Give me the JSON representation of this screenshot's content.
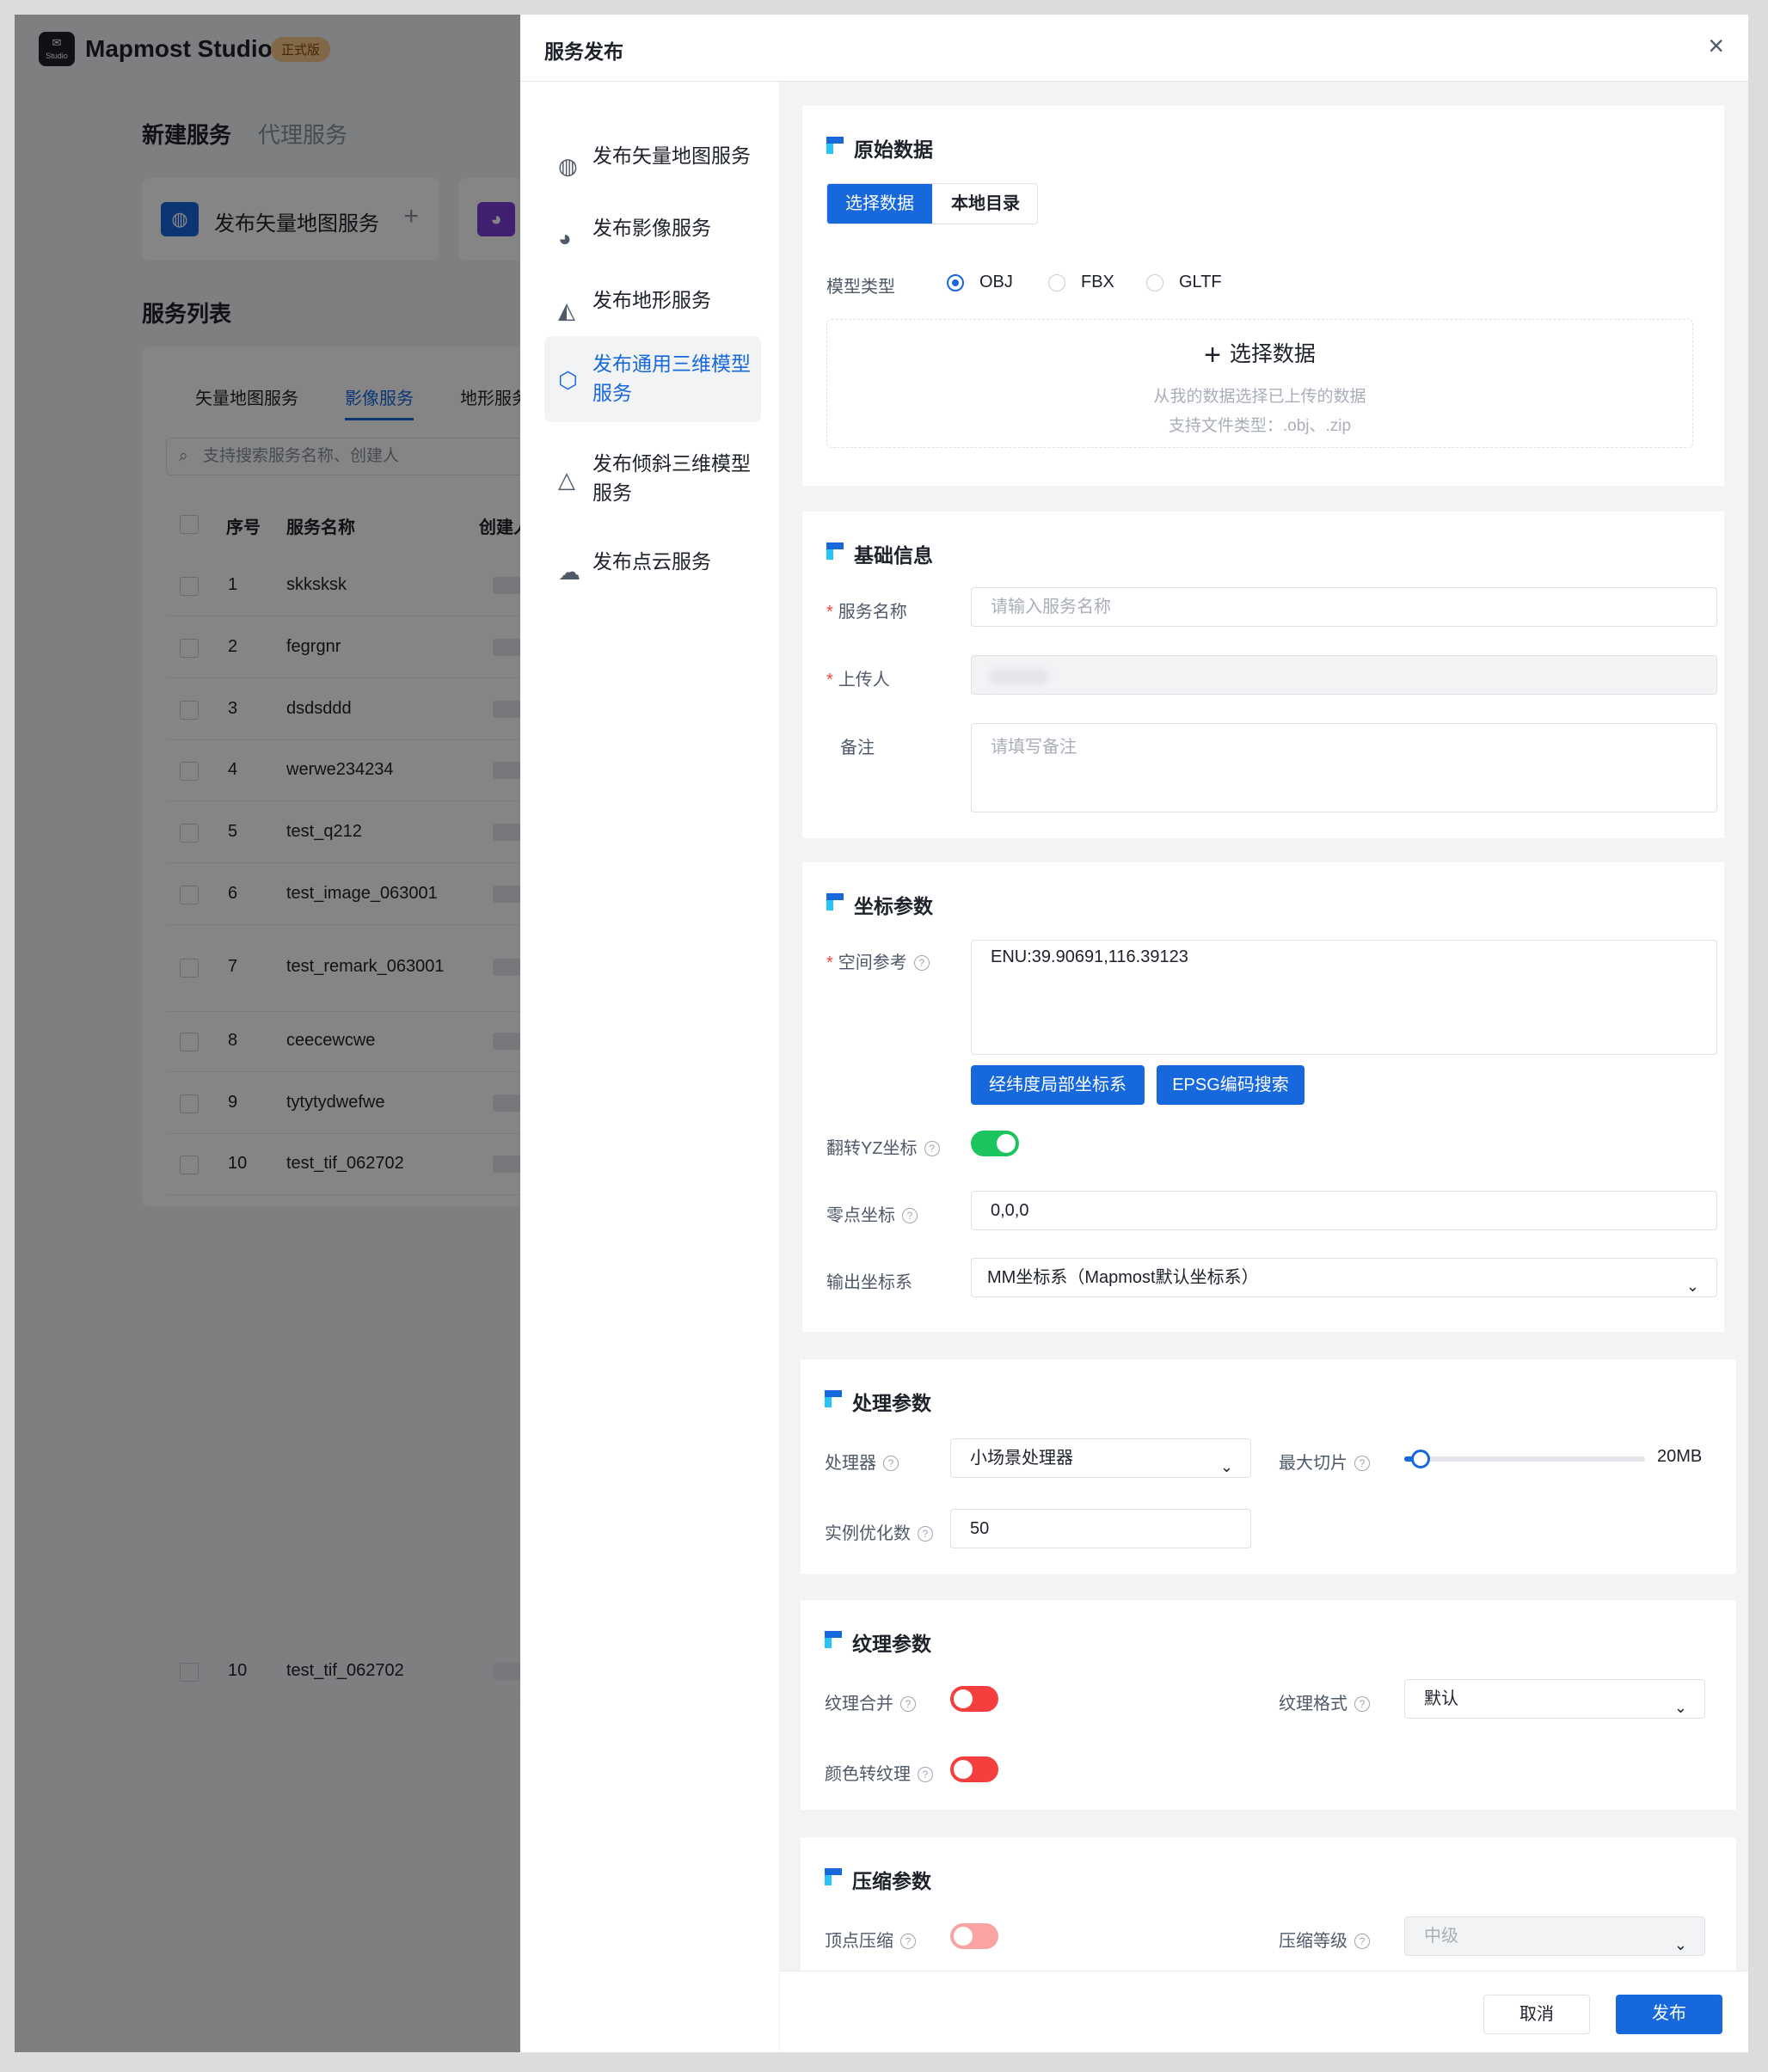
{
  "app": {
    "name": "Mapmost Studio",
    "logo_sub": "Studio",
    "edition_badge": "正式版"
  },
  "bg": {
    "tabs": [
      "新建服务",
      "代理服务"
    ],
    "cards": [
      {
        "label": "发布矢量地图服务",
        "plus": "+"
      }
    ],
    "list_title": "服务列表",
    "table_tabs": [
      "矢量地图服务",
      "影像服务",
      "地形服务"
    ],
    "search_placeholder": "支持搜索服务名称、创建人",
    "columns": [
      "序号",
      "服务名称",
      "创建人"
    ],
    "rows": [
      {
        "no": "1",
        "name": "skksksk"
      },
      {
        "no": "2",
        "name": "fegrgnr"
      },
      {
        "no": "3",
        "name": "dsdsddd"
      },
      {
        "no": "4",
        "name": "werwe234234"
      },
      {
        "no": "5",
        "name": "test_q212"
      },
      {
        "no": "6",
        "name": "test_image_063001"
      },
      {
        "no": "7",
        "name": "test_remark_063001"
      },
      {
        "no": "8",
        "name": "ceecewcwe"
      },
      {
        "no": "9",
        "name": "tytytydwefwe"
      },
      {
        "no": "10",
        "name": "test_tif_062702"
      },
      {
        "no": "10",
        "name": "test_tif_062702"
      }
    ]
  },
  "modal": {
    "title": "服务发布",
    "close": "×",
    "nav": [
      {
        "label": "发布矢量地图服务",
        "icon": "◍"
      },
      {
        "label": "发布影像服务",
        "icon": "◕"
      },
      {
        "label": "发布地形服务",
        "icon": "◭"
      },
      {
        "label": "发布通用三维模型服务",
        "icon": "⬡"
      },
      {
        "label": "发布倾斜三维模型服务",
        "icon": "△"
      },
      {
        "label": "发布点云服务",
        "icon": "☁"
      }
    ],
    "raw": {
      "title": "原始数据",
      "seg": [
        "选择数据",
        "本地目录"
      ],
      "model_type_label": "模型类型",
      "types": [
        "OBJ",
        "FBX",
        "GLTF"
      ],
      "selected_type": "OBJ",
      "upload_title": "选择数据",
      "upload_hint1": "从我的数据选择已上传的数据",
      "upload_hint2": "支持文件类型：.obj、.zip"
    },
    "basic": {
      "title": "基础信息",
      "name_label": "服务名称",
      "name_placeholder": "请输入服务名称",
      "uploader_label": "上传人",
      "remark_label": "备注",
      "remark_placeholder": "请填写备注"
    },
    "coord": {
      "title": "坐标参数",
      "srs_label": "空间参考",
      "srs_value": "ENU:39.90691,116.39123",
      "btn_local": "经纬度局部坐标系",
      "btn_epsg": "EPSG编码搜索",
      "flip_label": "翻转YZ坐标",
      "flip_on": true,
      "origin_label": "零点坐标",
      "origin_value": "0,0,0",
      "output_label": "输出坐标系",
      "output_value": "MM坐标系（Mapmost默认坐标系）"
    },
    "process": {
      "title": "处理参数",
      "processor_label": "处理器",
      "processor_value": "小场景处理器",
      "max_tile_label": "最大切片",
      "max_tile_value": "20MB",
      "max_tile_fraction": 0.03,
      "instance_label": "实例优化数",
      "instance_value": "50"
    },
    "texture": {
      "title": "纹理参数",
      "merge_label": "纹理合并",
      "format_label": "纹理格式",
      "format_value": "默认",
      "color_label": "颜色转纹理"
    },
    "compress": {
      "title": "压缩参数",
      "vertex_label": "顶点压缩",
      "level_label": "压缩等级",
      "level_value": "中级"
    },
    "footer": {
      "cancel": "取消",
      "publish": "发布"
    }
  },
  "colors": {
    "primary": "#1668dc",
    "success": "#1bc45c",
    "danger": "#f53f3f"
  }
}
